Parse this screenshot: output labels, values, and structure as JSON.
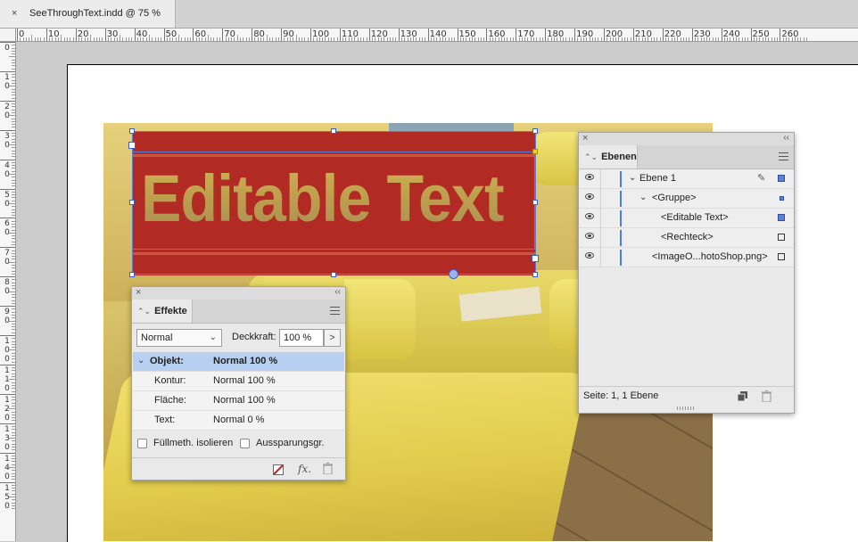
{
  "document": {
    "tab_title": "SeeThroughText.indd @ 75 %",
    "close_glyph": "×"
  },
  "rulers": {
    "horizontal_labels": [
      "0",
      "10",
      "20",
      "30",
      "40",
      "50",
      "60",
      "70",
      "80",
      "90",
      "100",
      "110",
      "120",
      "130",
      "140",
      "150",
      "160",
      "170",
      "180",
      "190",
      "200",
      "210",
      "220",
      "230",
      "240",
      "250",
      "260"
    ],
    "vertical_labels": [
      "0",
      "1\n0",
      "2\n0",
      "3\n0",
      "4\n0",
      "5\n0",
      "6\n0",
      "7\n0",
      "8\n0",
      "9\n0",
      "1\n0\n0",
      "1\n1\n0",
      "1\n2\n0",
      "1\n3\n0",
      "1\n4\n0",
      "1\n5\n0"
    ]
  },
  "canvas": {
    "see_through_text": "Editable Text",
    "rect_color": "#b12b24",
    "selection_color": "#5a7bd6"
  },
  "effects_panel": {
    "tab_label": "Effekte",
    "tab_arrows": "⌃⌄",
    "blend_mode": "Normal",
    "opacity_label": "Deckkraft:",
    "opacity_value": "100 %",
    "opacity_button": ">",
    "rows": [
      {
        "name": "Objekt:",
        "value": "Normal 100 %",
        "selected": true
      },
      {
        "name": "Kontur:",
        "value": "Normal 100 %",
        "selected": false
      },
      {
        "name": "Fläche:",
        "value": "Normal 100 %",
        "selected": false
      },
      {
        "name": "Text:",
        "value": "Normal 0 %",
        "selected": false
      }
    ],
    "checkbox_isolate": "Füllmeth. isolieren",
    "checkbox_knockout": "Aussparungsgr.",
    "footer_icons": [
      "clear-effects-icon",
      "fx-icon",
      "trash-icon"
    ],
    "fx_label": "fx."
  },
  "layers_panel": {
    "tab_label": "Ebenen",
    "tab_arrows": "⌃⌄",
    "rows": [
      {
        "name": "Ebene 1",
        "expanded": true
      },
      {
        "name": "<Gruppe>",
        "expanded": true
      },
      {
        "name": "<Editable Text>"
      },
      {
        "name": "<Rechteck>"
      },
      {
        "name": "<ImageO...hotoShop.png>"
      }
    ],
    "status": "Seite: 1, 1 Ebene",
    "layer_color": "#4a7ee0"
  }
}
